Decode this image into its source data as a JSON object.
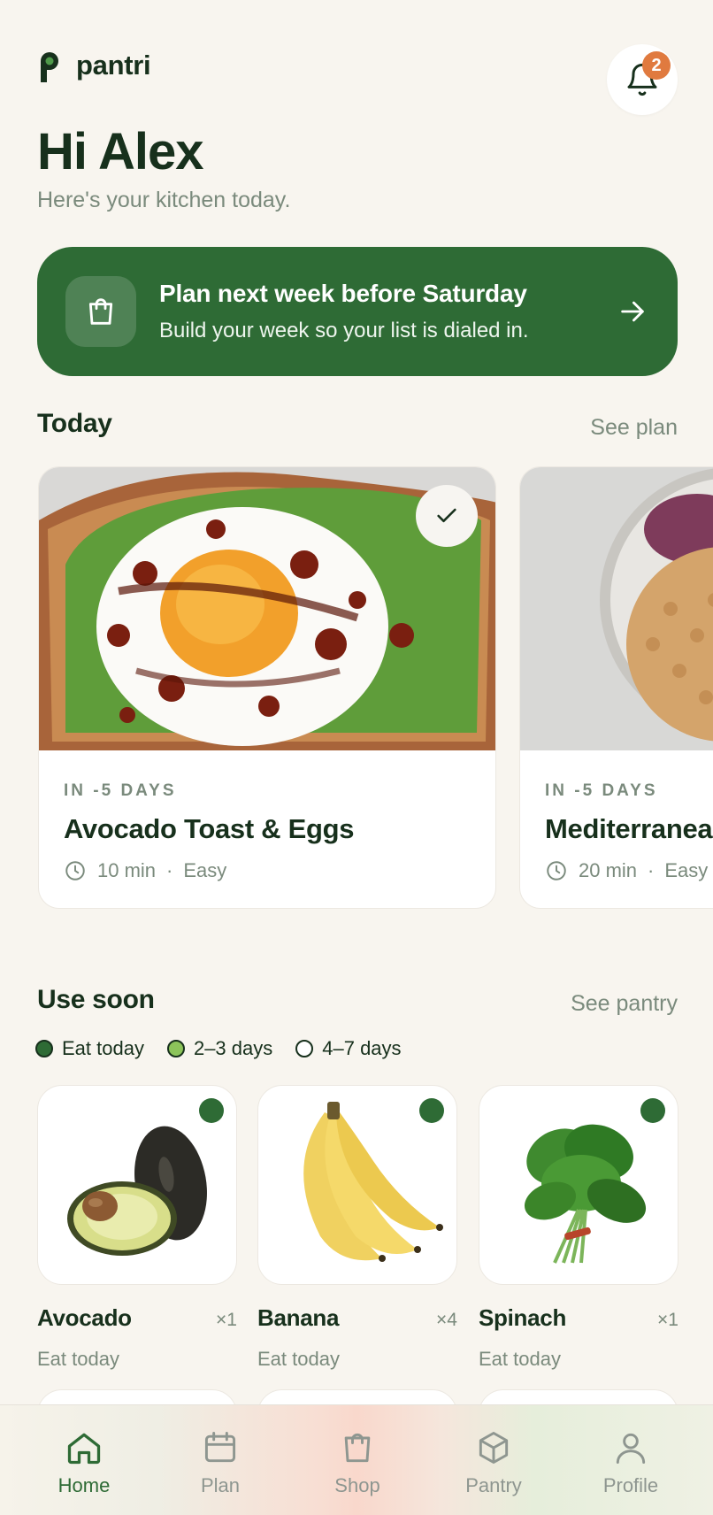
{
  "header": {
    "brand": "pantri",
    "notification_count": "2"
  },
  "greeting": {
    "title": "Hi Alex",
    "subtitle": "Here's your kitchen today."
  },
  "banner": {
    "title": "Plan next week before Saturday",
    "subtitle": "Build your week so your list is dialed in.",
    "icon": "shopping-bag-icon"
  },
  "today": {
    "title": "Today",
    "link": "See plan",
    "meals": [
      {
        "when": "IN -5 DAYS",
        "name": "Avocado Toast & Eggs",
        "time": "10 min",
        "sep": "·",
        "difficulty": "Easy",
        "done": true
      },
      {
        "when": "IN -5 DAYS",
        "name": "Mediterranean",
        "time": "20 min",
        "sep": "·",
        "difficulty": "Easy",
        "done": false
      }
    ]
  },
  "use_soon": {
    "title": "Use soon",
    "link": "See pantry",
    "legend": [
      {
        "label": "Eat today",
        "color": "#2e6b35"
      },
      {
        "label": "2–3 days",
        "color": "#8cc45a"
      },
      {
        "label": "4–7 days",
        "color": "#ffffff"
      }
    ],
    "items": [
      {
        "name": "Avocado",
        "qty": "×1",
        "status": "Eat today"
      },
      {
        "name": "Banana",
        "qty": "×4",
        "status": "Eat today"
      },
      {
        "name": "Spinach",
        "qty": "×1",
        "status": "Eat today"
      }
    ]
  },
  "nav": [
    {
      "label": "Home",
      "icon": "home-icon",
      "active": true
    },
    {
      "label": "Plan",
      "icon": "calendar-icon",
      "active": false
    },
    {
      "label": "Shop",
      "icon": "shopping-bag-icon",
      "active": false
    },
    {
      "label": "Pantry",
      "icon": "box-icon",
      "active": false
    },
    {
      "label": "Profile",
      "icon": "user-icon",
      "active": false
    }
  ],
  "colors": {
    "brand_green": "#2e6b35",
    "accent_orange": "#e07a3f",
    "background": "#f8f5ef"
  }
}
